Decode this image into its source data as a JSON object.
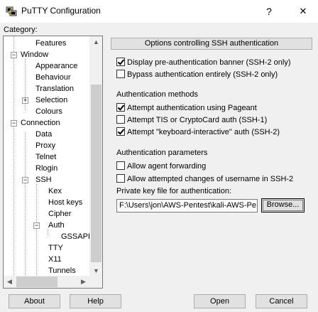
{
  "window": {
    "title": "PuTTY Configuration",
    "help_glyph": "?",
    "close_glyph": "✕"
  },
  "category_label": "Category:",
  "tree": {
    "items": [
      {
        "label": "Features"
      },
      {
        "label": "Window",
        "expander": "−"
      },
      {
        "label": "Appearance"
      },
      {
        "label": "Behaviour"
      },
      {
        "label": "Translation"
      },
      {
        "label": "Selection",
        "expander": "+"
      },
      {
        "label": "Colours"
      },
      {
        "label": "Connection",
        "expander": "−"
      },
      {
        "label": "Data"
      },
      {
        "label": "Proxy"
      },
      {
        "label": "Telnet"
      },
      {
        "label": "Rlogin"
      },
      {
        "label": "SSH",
        "expander": "−"
      },
      {
        "label": "Kex"
      },
      {
        "label": "Host keys"
      },
      {
        "label": "Cipher"
      },
      {
        "label": "Auth",
        "expander": "−"
      },
      {
        "label": "GSSAPI"
      },
      {
        "label": "TTY"
      },
      {
        "label": "X11"
      },
      {
        "label": "Tunnels"
      }
    ]
  },
  "panel": {
    "header": "Options controlling SSH authentication",
    "banner": {
      "display": {
        "label": "Display pre-authentication banner (SSH-2 only)",
        "checked": true
      },
      "bypass": {
        "label": "Bypass authentication entirely (SSH-2 only)",
        "checked": false
      }
    },
    "methods": {
      "title": "Authentication methods",
      "pageant": {
        "label": "Attempt authentication using Pageant",
        "checked": true
      },
      "tis": {
        "label": "Attempt TIS or CryptoCard auth (SSH-1)",
        "checked": false
      },
      "ki": {
        "label": "Attempt \"keyboard-interactive\" auth (SSH-2)",
        "checked": true
      }
    },
    "params": {
      "title": "Authentication parameters",
      "agent_fwd": {
        "label": "Allow agent forwarding",
        "checked": false
      },
      "username_change": {
        "label": "Allow attempted changes of username in SSH-2",
        "checked": false
      },
      "keyfile_label": "Private key file for authentication:",
      "keyfile_value": "F:\\Users\\jon\\AWS-Pentest\\kali-AWS-Pe",
      "browse_label": "Browse..."
    }
  },
  "buttons": {
    "about": "About",
    "help": "Help",
    "open": "Open",
    "cancel": "Cancel"
  }
}
